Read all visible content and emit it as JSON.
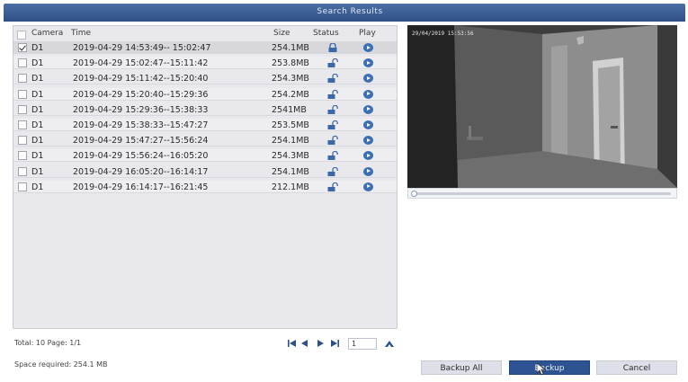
{
  "window": {
    "title": "Search Results"
  },
  "table": {
    "columns": {
      "camera": "Camera",
      "time": "Time",
      "size": "Size",
      "status": "Status",
      "play": "Play"
    },
    "rows": [
      {
        "checked": true,
        "camera": "D1",
        "time": "2019-04-29 14:53:49-- 15:02:47",
        "size": "254.1MB",
        "status": "locked-icon",
        "play": "play-icon"
      },
      {
        "checked": false,
        "camera": "D1",
        "time": "2019-04-29 15:02:47--15:11:42",
        "size": "253.8MB",
        "status": "unlocked-icon",
        "play": "play-icon"
      },
      {
        "checked": false,
        "camera": "D1",
        "time": "2019-04-29 15:11:42--15:20:40",
        "size": "254.3MB",
        "status": "unlocked-icon",
        "play": "play-icon"
      },
      {
        "checked": false,
        "camera": "D1",
        "time": "2019-04-29 15:20:40--15:29:36",
        "size": "254.2MB",
        "status": "unlocked-icon",
        "play": "play-icon"
      },
      {
        "checked": false,
        "camera": "D1",
        "time": "2019-04-29 15:29:36--15:38:33",
        "size": "2541MB",
        "status": "unlocked-icon",
        "play": "play-icon"
      },
      {
        "checked": false,
        "camera": "D1",
        "time": "2019-04-29 15:38:33--15:47:27",
        "size": "253.5MB",
        "status": "unlocked-icon",
        "play": "play-icon"
      },
      {
        "checked": false,
        "camera": "D1",
        "time": "2019-04-29 15:47:27--15:56:24",
        "size": "254.1MB",
        "status": "unlocked-icon",
        "play": "play-icon"
      },
      {
        "checked": false,
        "camera": "D1",
        "time": "2019-04-29 15:56:24--16:05:20",
        "size": "254.3MB",
        "status": "unlocked-icon",
        "play": "play-icon"
      },
      {
        "checked": false,
        "camera": "D1",
        "time": "2019-04-29 16:05:20--16:14:17",
        "size": "254.1MB",
        "status": "unlocked-icon",
        "play": "play-icon"
      },
      {
        "checked": false,
        "camera": "D1",
        "time": "2019-04-29 16:14:17--16:21:45",
        "size": "212.1MB",
        "status": "unlocked-icon",
        "play": "play-icon"
      }
    ]
  },
  "preview": {
    "timestamp": "29/04/2019 15:53:56",
    "progress": 0.0
  },
  "footer": {
    "total": "Total: 10  Page: 1/1",
    "page_input": "1",
    "space_required": "Space required: 254.1 MB",
    "pager_icons": [
      "first-page-icon",
      "prev-page-icon",
      "next-page-icon",
      "last-page-icon",
      "go-icon"
    ]
  },
  "buttons": {
    "backup_all": "Backup All",
    "backup": "Backup",
    "cancel": "Cancel"
  },
  "colors": {
    "title_bar": "#2f4f86",
    "primary_button": "#2e5393",
    "play_icon": "#3c6fb4",
    "panel": "#e9e9ed"
  }
}
